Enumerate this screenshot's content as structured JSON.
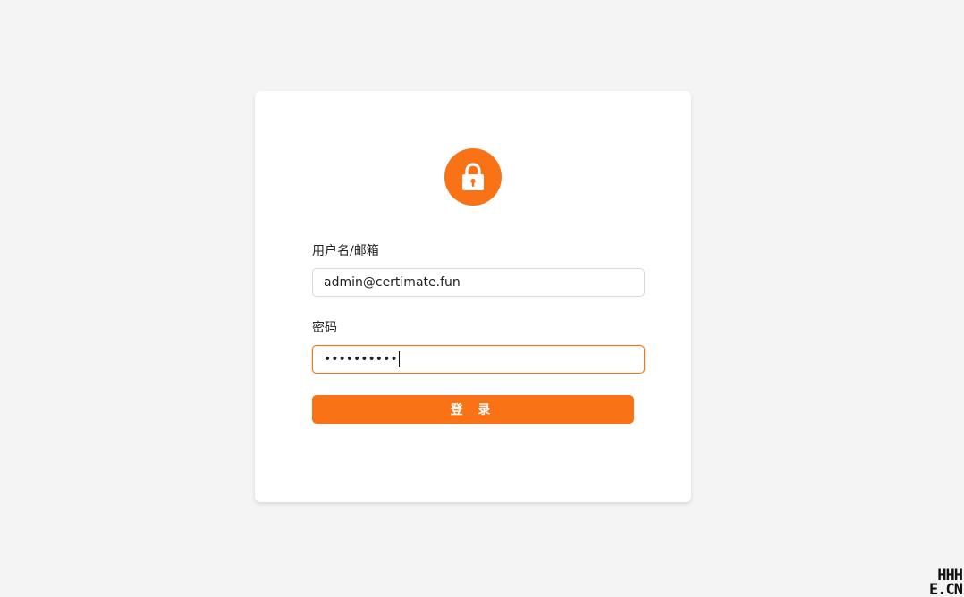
{
  "login": {
    "username_label": "用户名/邮箱",
    "username_value": "admin@certimate.fun",
    "password_label": "密码",
    "password_value": "••••••••••",
    "submit_label": "登 录"
  },
  "icons": {
    "header": "lock-icon"
  },
  "colors": {
    "accent": "#f97316",
    "background": "#f4f4f4",
    "card": "#ffffff"
  },
  "watermark": {
    "line1": "HHH",
    "line2": "E.CN"
  }
}
